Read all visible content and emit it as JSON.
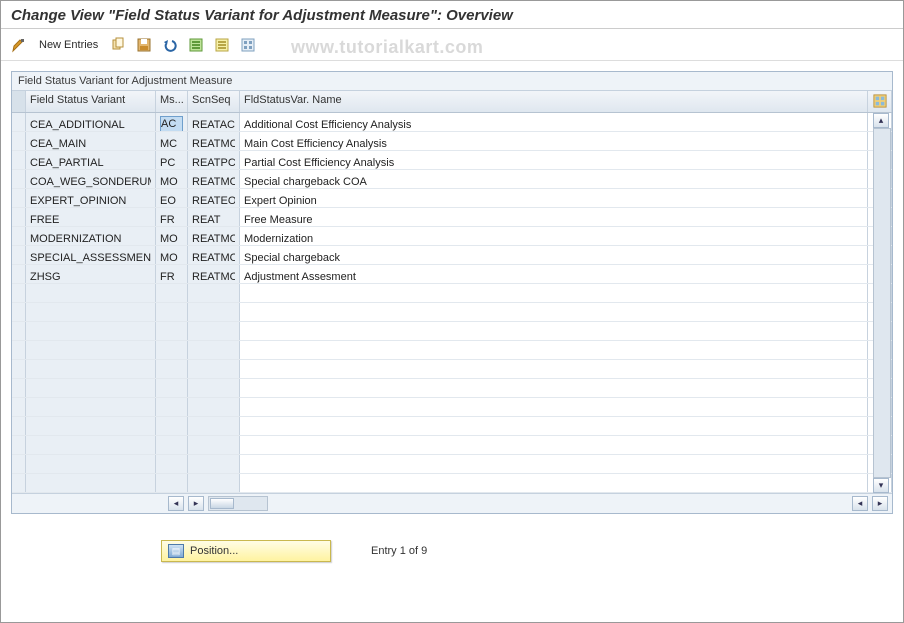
{
  "title": "Change View \"Field Status Variant for Adjustment Measure\": Overview",
  "watermark": "www.tutorialkart.com",
  "toolbar": {
    "new_entries_label": "New Entries"
  },
  "panel": {
    "title": "Field Status Variant for Adjustment Measure"
  },
  "columns": {
    "fsv": "Field Status Variant",
    "ms": "Ms...",
    "seq": "ScnSeq",
    "name": "FldStatusVar. Name"
  },
  "rows": [
    {
      "fsv": "CEA_ADDITIONAL",
      "ms": "AC",
      "seq": "REATAC",
      "name": "Additional Cost Efficiency Analysis"
    },
    {
      "fsv": "CEA_MAIN",
      "ms": "MC",
      "seq": "REATMC",
      "name": "Main Cost Efficiency Analysis"
    },
    {
      "fsv": "CEA_PARTIAL",
      "ms": "PC",
      "seq": "REATPC",
      "name": "Partial Cost Efficiency Analysis"
    },
    {
      "fsv": "COA_WEG_SONDERUMLAGE",
      "ms": "MO",
      "seq": "REATMO",
      "name": "Special chargeback COA"
    },
    {
      "fsv": "EXPERT_OPINION",
      "ms": "EO",
      "seq": "REATEO",
      "name": "Expert Opinion"
    },
    {
      "fsv": "FREE",
      "ms": "FR",
      "seq": "REAT",
      "name": "Free Measure"
    },
    {
      "fsv": "MODERNIZATION",
      "ms": "MO",
      "seq": "REATMO",
      "name": "Modernization"
    },
    {
      "fsv": "SPECIAL_ASSESSMENT",
      "ms": "MO",
      "seq": "REATMO",
      "name": "Special chargeback"
    },
    {
      "fsv": "ZHSG",
      "ms": "FR",
      "seq": "REATMO",
      "name": "Adjustment Assesment"
    }
  ],
  "empty_row_count": 11,
  "footer": {
    "position_label": "Position...",
    "entry_text": "Entry 1 of 9"
  },
  "icons": {
    "toggle": "toggle-icon",
    "copy": "copy-icon",
    "save": "save-icon",
    "undo": "undo-icon",
    "select_all": "select-all-icon",
    "deselect_all": "deselect-all-icon",
    "config": "config-icon",
    "table_settings": "table-settings-icon"
  }
}
